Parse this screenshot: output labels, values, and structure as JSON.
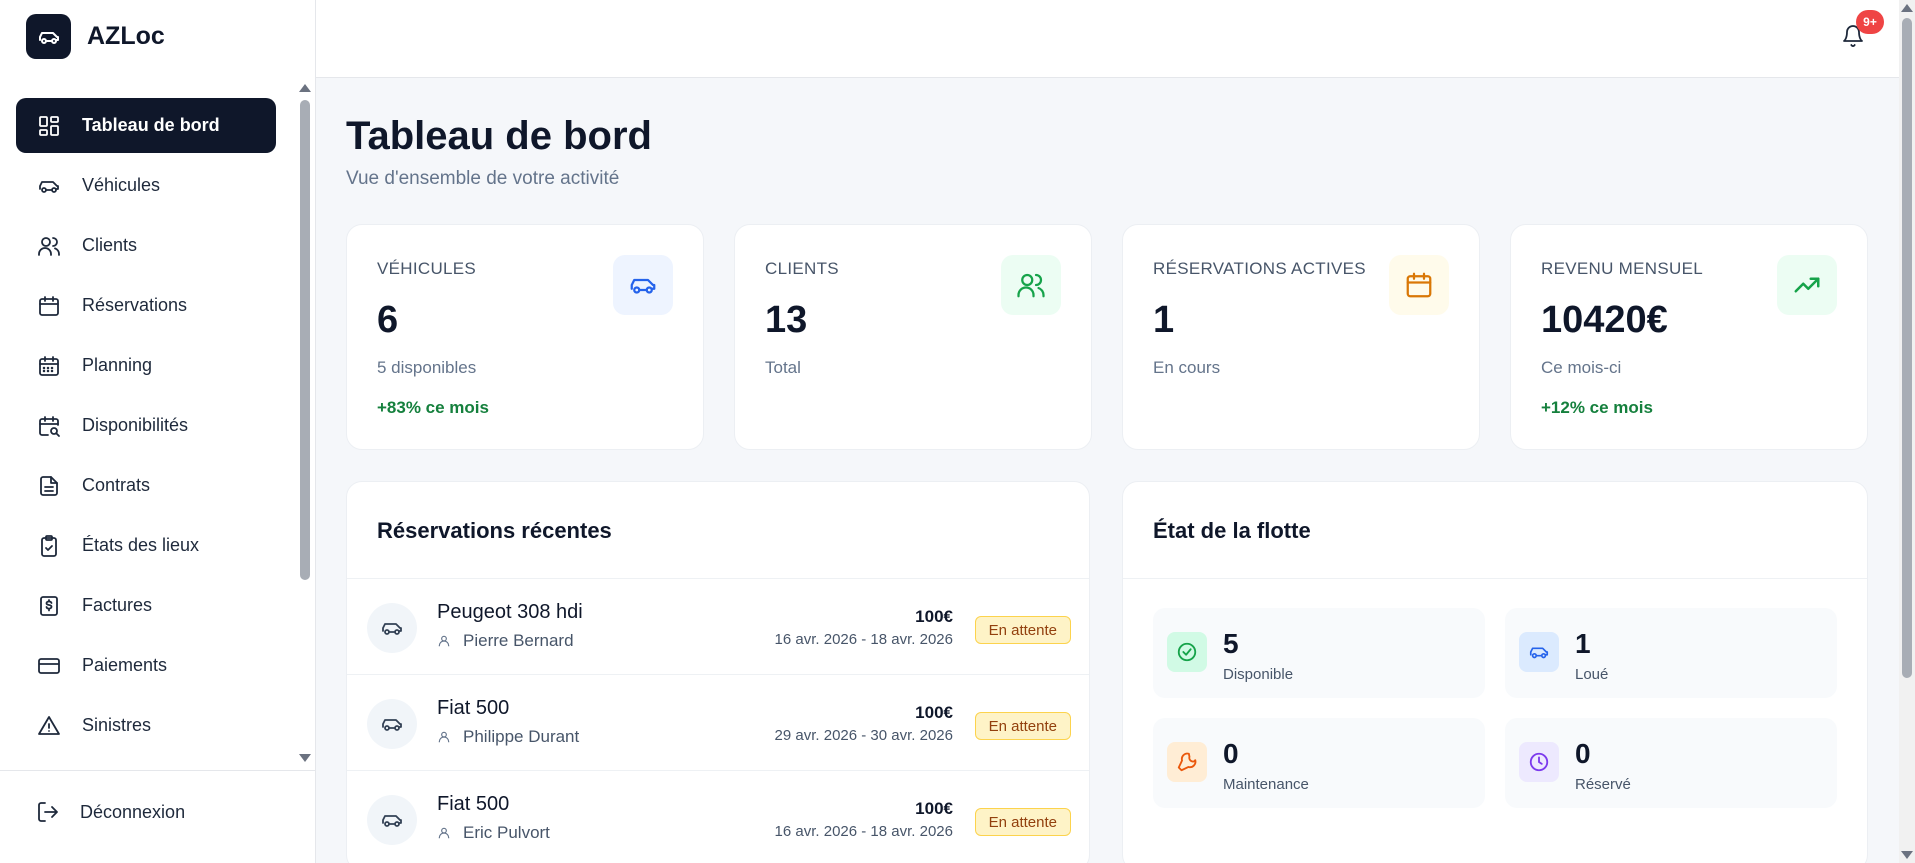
{
  "app": {
    "name": "AZLoc",
    "logo_icon": "car-icon"
  },
  "sidebar": {
    "items": [
      {
        "label": "Tableau de bord",
        "icon": "dashboard-icon",
        "active": true
      },
      {
        "label": "Véhicules",
        "icon": "car-icon"
      },
      {
        "label": "Clients",
        "icon": "users-icon"
      },
      {
        "label": "Réservations",
        "icon": "calendar-icon"
      },
      {
        "label": "Planning",
        "icon": "calendar-grid-icon"
      },
      {
        "label": "Disponibilités",
        "icon": "calendar-search-icon"
      },
      {
        "label": "Contrats",
        "icon": "document-icon"
      },
      {
        "label": "États des lieux",
        "icon": "clipboard-check-icon"
      },
      {
        "label": "Factures",
        "icon": "invoice-dollar-icon"
      },
      {
        "label": "Paiements",
        "icon": "credit-card-icon"
      },
      {
        "label": "Sinistres",
        "icon": "warning-icon"
      }
    ],
    "logout": "Déconnexion"
  },
  "topbar": {
    "notification_count": "9+"
  },
  "header": {
    "title": "Tableau de bord",
    "subtitle": "Vue d'ensemble de votre activité"
  },
  "stats": [
    {
      "label": "VÉHICULES",
      "value": "6",
      "sub": "5 disponibles",
      "trend": "+83% ce mois",
      "icon": "car-icon",
      "color": "#2563eb",
      "bg": "#eef4ff"
    },
    {
      "label": "CLIENTS",
      "value": "13",
      "sub": "Total",
      "trend": "",
      "icon": "users-icon",
      "color": "#16a34a",
      "bg": "#ecfdf3"
    },
    {
      "label": "RÉSERVATIONS ACTIVES",
      "value": "1",
      "sub": "En cours",
      "trend": "",
      "icon": "calendar-icon",
      "color": "#d97706",
      "bg": "#fffbeb"
    },
    {
      "label": "REVENU MENSUEL",
      "value": "10420€",
      "sub": "Ce mois-ci",
      "trend": "+12% ce mois",
      "icon": "trending-up-icon",
      "color": "#16a34a",
      "bg": "#ecfdf3"
    }
  ],
  "recent": {
    "title": "Réservations récentes",
    "rows": [
      {
        "model": "Peugeot 308 hdi",
        "client": "Pierre Bernard",
        "price": "100€",
        "dates": "16 avr. 2026 - 18 avr. 2026",
        "status": "En attente"
      },
      {
        "model": "Fiat 500",
        "client": "Philippe Durant",
        "price": "100€",
        "dates": "29 avr. 2026 - 30 avr. 2026",
        "status": "En attente"
      },
      {
        "model": "Fiat 500",
        "client": "Eric Pulvort",
        "price": "100€",
        "dates": "16 avr. 2026 - 18 avr. 2026",
        "status": "En attente"
      }
    ]
  },
  "fleet": {
    "title": "État de la flotte",
    "items": [
      {
        "value": "5",
        "label": "Disponible",
        "icon": "check-circle-icon",
        "color": "#16a34a",
        "bg": "#d1fae5"
      },
      {
        "value": "1",
        "label": "Loué",
        "icon": "car-icon",
        "color": "#2563eb",
        "bg": "#dbeafe"
      },
      {
        "value": "0",
        "label": "Maintenance",
        "icon": "wrench-icon",
        "color": "#ea580c",
        "bg": "#ffedd5"
      },
      {
        "value": "0",
        "label": "Réservé",
        "icon": "clock-icon",
        "color": "#7c3aed",
        "bg": "#ede9fe"
      }
    ]
  }
}
